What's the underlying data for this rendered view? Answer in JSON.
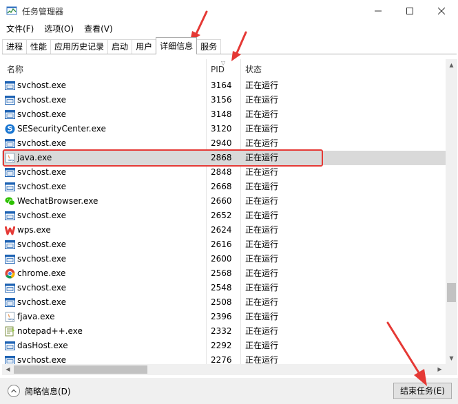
{
  "window": {
    "title": "任务管理器"
  },
  "menu": [
    {
      "label": "文件(F)"
    },
    {
      "label": "选项(O)"
    },
    {
      "label": "查看(V)"
    }
  ],
  "tabs": [
    {
      "label": "进程",
      "active": false
    },
    {
      "label": "性能",
      "active": false
    },
    {
      "label": "应用历史记录",
      "active": false
    },
    {
      "label": "启动",
      "active": false
    },
    {
      "label": "用户",
      "active": false
    },
    {
      "label": "详细信息",
      "active": true
    },
    {
      "label": "服务",
      "active": false
    }
  ],
  "columns": {
    "name": "名称",
    "pid": "PID",
    "status": "状态"
  },
  "rows": [
    {
      "name": "svchost.exe",
      "pid": "3164",
      "status": "正在运行",
      "icon": "svchost-icon"
    },
    {
      "name": "svchost.exe",
      "pid": "3156",
      "status": "正在运行",
      "icon": "svchost-icon"
    },
    {
      "name": "svchost.exe",
      "pid": "3148",
      "status": "正在运行",
      "icon": "svchost-icon"
    },
    {
      "name": "SESecurityCenter.exe",
      "pid": "3120",
      "status": "正在运行",
      "icon": "security-center-icon"
    },
    {
      "name": "svchost.exe",
      "pid": "2940",
      "status": "正在运行",
      "icon": "svchost-icon"
    },
    {
      "name": "java.exe",
      "pid": "2868",
      "status": "正在运行",
      "icon": "java-icon",
      "selected": true
    },
    {
      "name": "svchost.exe",
      "pid": "2848",
      "status": "正在运行",
      "icon": "svchost-icon"
    },
    {
      "name": "svchost.exe",
      "pid": "2668",
      "status": "正在运行",
      "icon": "svchost-icon"
    },
    {
      "name": "WechatBrowser.exe",
      "pid": "2660",
      "status": "正在运行",
      "icon": "wechat-icon"
    },
    {
      "name": "svchost.exe",
      "pid": "2652",
      "status": "正在运行",
      "icon": "svchost-icon"
    },
    {
      "name": "wps.exe",
      "pid": "2624",
      "status": "正在运行",
      "icon": "wps-icon"
    },
    {
      "name": "svchost.exe",
      "pid": "2616",
      "status": "正在运行",
      "icon": "svchost-icon"
    },
    {
      "name": "svchost.exe",
      "pid": "2600",
      "status": "正在运行",
      "icon": "svchost-icon"
    },
    {
      "name": "chrome.exe",
      "pid": "2568",
      "status": "正在运行",
      "icon": "chrome-icon"
    },
    {
      "name": "svchost.exe",
      "pid": "2548",
      "status": "正在运行",
      "icon": "svchost-icon"
    },
    {
      "name": "svchost.exe",
      "pid": "2508",
      "status": "正在运行",
      "icon": "svchost-icon"
    },
    {
      "name": "fjava.exe",
      "pid": "2396",
      "status": "正在运行",
      "icon": "java-icon"
    },
    {
      "name": "notepad++.exe",
      "pid": "2332",
      "status": "正在运行",
      "icon": "notepad-plus-plus-icon"
    },
    {
      "name": "dasHost.exe",
      "pid": "2292",
      "status": "正在运行",
      "icon": "svchost-icon"
    },
    {
      "name": "svchost.exe",
      "pid": "2276",
      "status": "正在运行",
      "icon": "svchost-icon"
    }
  ],
  "footer": {
    "less_details": "简略信息(D)",
    "end_task": "结束任务(E)"
  },
  "colors": {
    "selected_row": "#d9d9d9",
    "annotation_red": "#e53935"
  }
}
